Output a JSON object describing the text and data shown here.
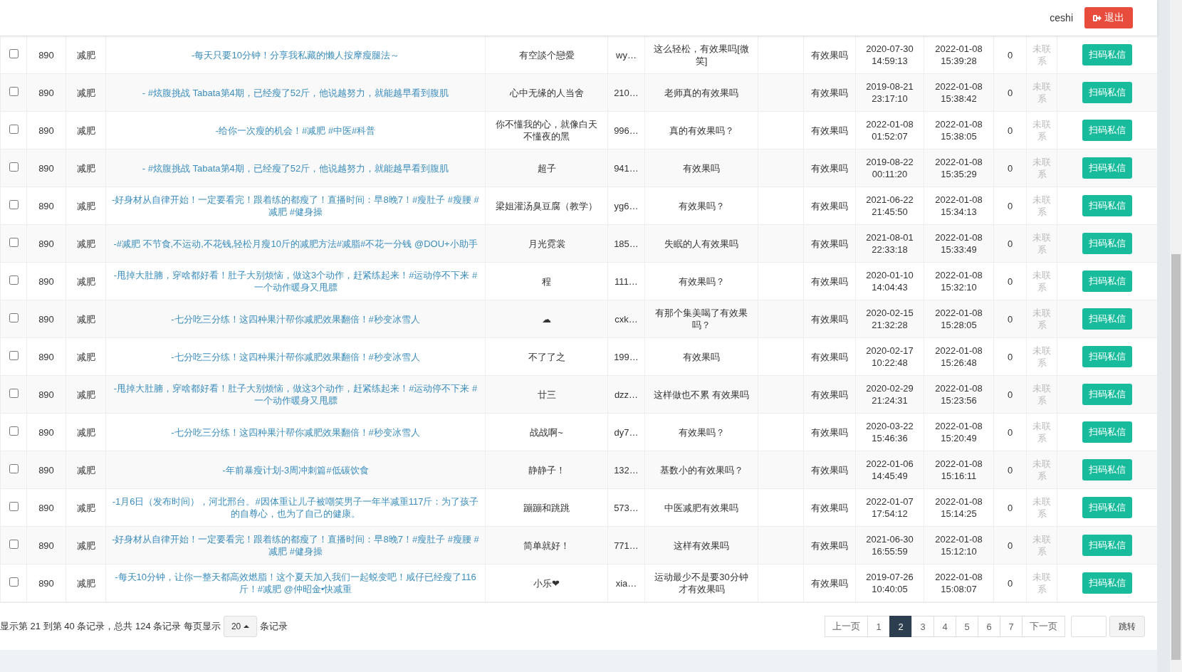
{
  "header": {
    "username": "ceshi",
    "logout_button": "退出"
  },
  "table": {
    "rows": [
      {
        "checked": false,
        "id": "890",
        "category": "减肥",
        "title": "-每天只要10分钟！分享我私藏的懒人按摩瘦腿法～",
        "nickname": "有空談个戀愛",
        "uid": "wy…",
        "comment": "这么轻松，有效果吗[微笑]",
        "keyword": "有效果吗",
        "created": "2020-07-30 14:59:13",
        "updated": "2022-01-08 15:39:28",
        "count": "0",
        "status": "未联系",
        "action": "扫码私信"
      },
      {
        "checked": false,
        "id": "890",
        "category": "减肥",
        "title": "- #炫腹挑战 Tabata第4期，已经瘦了52斤，他说越努力，就能越早看到腹肌",
        "nickname": "心中无缘的人当舍",
        "uid": "210…",
        "comment": "老师真的有效果吗",
        "keyword": "有效果吗",
        "created": "2019-08-21 23:17:10",
        "updated": "2022-01-08 15:38:42",
        "count": "0",
        "status": "未联系",
        "action": "扫码私信"
      },
      {
        "checked": false,
        "id": "890",
        "category": "减肥",
        "title": "-给你一次瘦的机会！#减肥 #中医#科普",
        "nickname": "你不懂我的心，就像白天不懂夜的黑",
        "uid": "996…",
        "comment": "真的有效果吗？",
        "keyword": "有效果吗",
        "created": "2022-01-08 01:52:07",
        "updated": "2022-01-08 15:38:05",
        "count": "0",
        "status": "未联系",
        "action": "扫码私信"
      },
      {
        "checked": false,
        "id": "890",
        "category": "减肥",
        "title": "- #炫腹挑战 Tabata第4期，已经瘦了52斤，他说越努力，就能越早看到腹肌",
        "nickname": "超子",
        "uid": "941…",
        "comment": "有效果吗",
        "keyword": "有效果吗",
        "created": "2019-08-22 00:11:20",
        "updated": "2022-01-08 15:35:29",
        "count": "0",
        "status": "未联系",
        "action": "扫码私信"
      },
      {
        "checked": false,
        "id": "890",
        "category": "减肥",
        "title": "-好身材从自律开始！一定要看完！跟着练的都瘦了！直播时间：早8晚7！#瘦肚子 #瘦腰 #减肥 #健身操",
        "nickname": "梁姐灌汤臭豆腐（教学）",
        "uid": "yg6…",
        "comment": "有效果吗？",
        "keyword": "有效果吗",
        "created": "2021-06-22 21:45:50",
        "updated": "2022-01-08 15:34:13",
        "count": "0",
        "status": "未联系",
        "action": "扫码私信"
      },
      {
        "checked": false,
        "id": "890",
        "category": "减肥",
        "title": "-#减肥 不节食,不运动,不花钱,轻松月瘦10斤的减肥方法#减脂#不花一分钱 @DOU+小助手",
        "nickname": "月光霓裳",
        "uid": "185…",
        "comment": "失眠的人有效果吗",
        "keyword": "有效果吗",
        "created": "2021-08-01 22:33:18",
        "updated": "2022-01-08 15:33:49",
        "count": "0",
        "status": "未联系",
        "action": "扫码私信"
      },
      {
        "checked": false,
        "id": "890",
        "category": "减肥",
        "title": "-甩掉大肚腩，穿啥都好看！肚子大别烦恼，做这3个动作，赶紧练起来！#运动停不下来 #一个动作暖身又甩膘",
        "nickname": "程",
        "uid": "111…",
        "comment": "有效果吗？",
        "keyword": "有效果吗",
        "created": "2020-01-10 14:04:43",
        "updated": "2022-01-08 15:32:10",
        "count": "0",
        "status": "未联系",
        "action": "扫码私信"
      },
      {
        "checked": false,
        "id": "890",
        "category": "减肥",
        "title": "-七分吃三分练！这四种果汁帮你减肥效果翻倍！#秒变冰雪人",
        "nickname": "☁",
        "uid": "cxk…",
        "comment": "有那个集美喝了有效果吗？",
        "keyword": "有效果吗",
        "created": "2020-02-15 21:32:28",
        "updated": "2022-01-08 15:28:05",
        "count": "0",
        "status": "未联系",
        "action": "扫码私信"
      },
      {
        "checked": false,
        "id": "890",
        "category": "减肥",
        "title": "-七分吃三分练！这四种果汁帮你减肥效果翻倍！#秒变冰雪人",
        "nickname": "不了了之",
        "uid": "199…",
        "comment": "有效果吗",
        "keyword": "有效果吗",
        "created": "2020-02-17 10:22:48",
        "updated": "2022-01-08 15:26:48",
        "count": "0",
        "status": "未联系",
        "action": "扫码私信"
      },
      {
        "checked": false,
        "id": "890",
        "category": "减肥",
        "title": "-甩掉大肚腩，穿啥都好看！肚子大别烦恼，做这3个动作，赶紧练起来！#运动停不下来 #一个动作暖身又甩膘",
        "nickname": "廿三",
        "uid": "dzz…",
        "comment": "这样做也不累 有效果吗",
        "keyword": "有效果吗",
        "created": "2020-02-29 21:24:31",
        "updated": "2022-01-08 15:23:56",
        "count": "0",
        "status": "未联系",
        "action": "扫码私信"
      },
      {
        "checked": false,
        "id": "890",
        "category": "减肥",
        "title": "-七分吃三分练！这四种果汁帮你减肥效果翻倍！#秒变冰雪人",
        "nickname": "战战啊~",
        "uid": "dy7…",
        "comment": "有效果吗？",
        "keyword": "有效果吗",
        "created": "2020-03-22 15:46:36",
        "updated": "2022-01-08 15:20:49",
        "count": "0",
        "status": "未联系",
        "action": "扫码私信"
      },
      {
        "checked": false,
        "id": "890",
        "category": "减肥",
        "title": "-年前暴瘦计划-3周冲刺篇#低碳饮食",
        "nickname": "静静子！",
        "uid": "132…",
        "comment": "基数小的有效果吗？",
        "keyword": "有效果吗",
        "created": "2022-01-06 14:45:49",
        "updated": "2022-01-08 15:16:11",
        "count": "0",
        "status": "未联系",
        "action": "扫码私信"
      },
      {
        "checked": false,
        "id": "890",
        "category": "减肥",
        "title": "-1月6日（发布时间），河北邢台。#因体重让儿子被嘲笑男子一年半减重117斤：为了孩子的自尊心，也为了自己的健康。",
        "nickname": "蹦蹦和跳跳",
        "uid": "573…",
        "comment": "中医减肥有效果吗",
        "keyword": "有效果吗",
        "created": "2022-01-07 17:54:12",
        "updated": "2022-01-08 15:14:25",
        "count": "0",
        "status": "未联系",
        "action": "扫码私信"
      },
      {
        "checked": false,
        "id": "890",
        "category": "减肥",
        "title": "-好身材从自律开始！一定要看完！跟着练的都瘦了！直播时间：早8晚7！#瘦肚子 #瘦腰 #减肥 #健身操",
        "nickname": "简单就好！",
        "uid": "771…",
        "comment": "这样有效果吗",
        "keyword": "有效果吗",
        "created": "2021-06-30 16:55:59",
        "updated": "2022-01-08 15:12:10",
        "count": "0",
        "status": "未联系",
        "action": "扫码私信"
      },
      {
        "checked": false,
        "id": "890",
        "category": "减肥",
        "title": "-每天10分钟，让你一整天都高效燃脂！这个夏天加入我们一起蜕变吧！咸仔已经瘦了116斤！#减肥 @仲昭金•快减重",
        "nickname": "小乐❤",
        "uid": "xia…",
        "comment": "运动最少不是要30分钟才有效果吗",
        "keyword": "有效果吗",
        "created": "2019-07-26 10:40:05",
        "updated": "2022-01-08 15:08:07",
        "count": "0",
        "status": "未联系",
        "action": "扫码私信"
      }
    ]
  },
  "footer": {
    "summary": "显示第 21 到第 40 条记录，总共 124 条记录 每页显示",
    "page_size": "20",
    "page_size_suffix": "条记录",
    "pagination": [
      {
        "label": "上一页",
        "selected": false
      },
      {
        "label": "1",
        "selected": false
      },
      {
        "label": "2",
        "selected": true
      },
      {
        "label": "3",
        "selected": false
      },
      {
        "label": "4",
        "selected": false
      },
      {
        "label": "5",
        "selected": false
      },
      {
        "label": "6",
        "selected": false
      },
      {
        "label": "7",
        "selected": false
      },
      {
        "label": "下一页",
        "selected": false
      }
    ],
    "jump_button": "跳转"
  }
}
